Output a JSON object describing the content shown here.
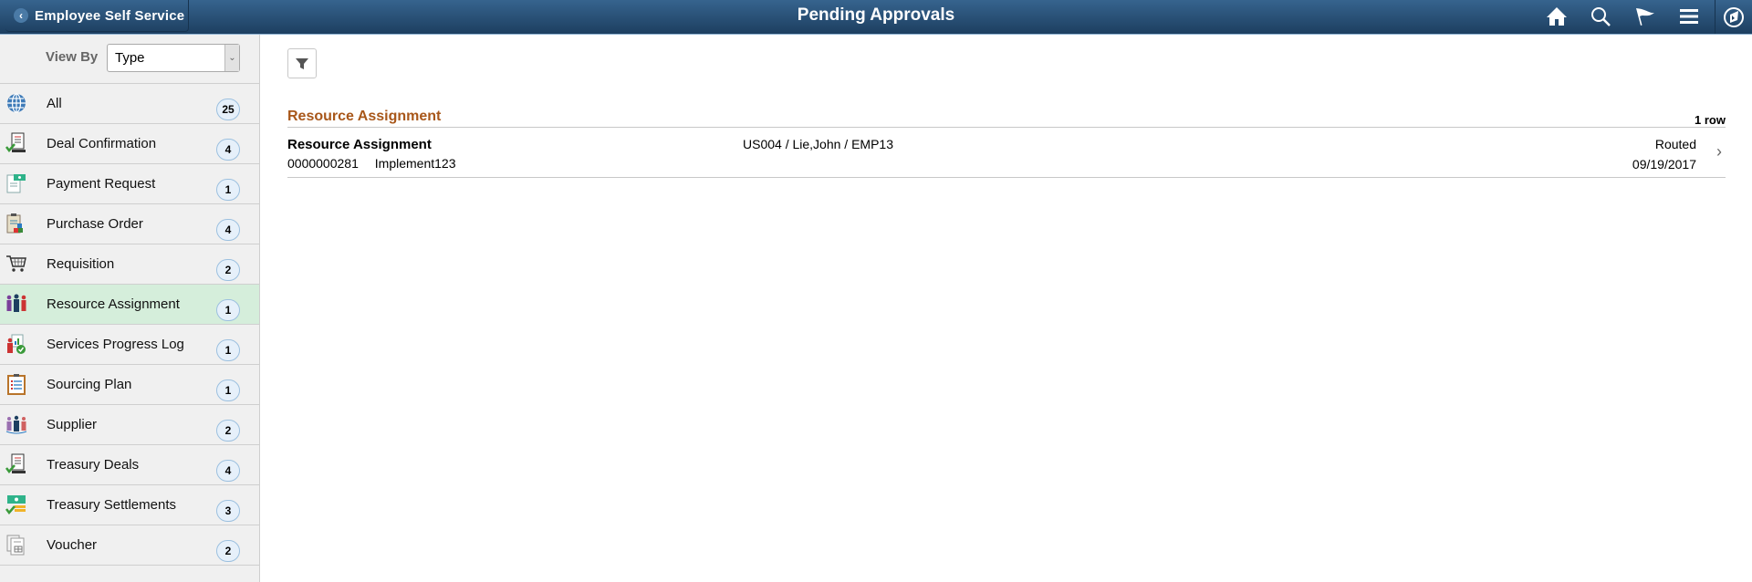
{
  "header": {
    "back_label": "Employee Self Service",
    "title": "Pending Approvals",
    "icons": [
      "home-icon",
      "search-icon",
      "flag-icon",
      "menu-icon",
      "navbar-compass-icon"
    ]
  },
  "sidebar": {
    "view_by_label": "View By",
    "view_by_value": "Type",
    "items": [
      {
        "label": "All",
        "count": "25",
        "icon": "globe-icon"
      },
      {
        "label": "Deal Confirmation",
        "count": "4",
        "icon": "document-check-icon"
      },
      {
        "label": "Payment Request",
        "count": "1",
        "icon": "payment-request-icon"
      },
      {
        "label": "Purchase Order",
        "count": "4",
        "icon": "clipboard-icon"
      },
      {
        "label": "Requisition",
        "count": "2",
        "icon": "cart-icon"
      },
      {
        "label": "Resource Assignment",
        "count": "1",
        "icon": "people-icon",
        "selected": true
      },
      {
        "label": "Services Progress Log",
        "count": "1",
        "icon": "progress-log-icon"
      },
      {
        "label": "Sourcing Plan",
        "count": "1",
        "icon": "clipboard-list-icon"
      },
      {
        "label": "Supplier",
        "count": "2",
        "icon": "supplier-icon"
      },
      {
        "label": "Treasury Deals",
        "count": "4",
        "icon": "document-check-icon"
      },
      {
        "label": "Treasury Settlements",
        "count": "3",
        "icon": "money-check-icon"
      },
      {
        "label": "Voucher",
        "count": "2",
        "icon": "voucher-icon"
      }
    ]
  },
  "main": {
    "group_title": "Resource Assignment",
    "row_count": "1 row",
    "rows": [
      {
        "title": "Resource Assignment",
        "id": "0000000281",
        "desc": "Implement123",
        "detail": "US004 / Lie,John / EMP13",
        "status": "Routed",
        "date": "09/19/2017"
      }
    ]
  },
  "colors": {
    "header_top": "#36648e",
    "header_bottom": "#1d3f60",
    "group_title": "#a8571a",
    "selected_row": "#d5eedb",
    "badge_bg": "#e6f0fa"
  }
}
